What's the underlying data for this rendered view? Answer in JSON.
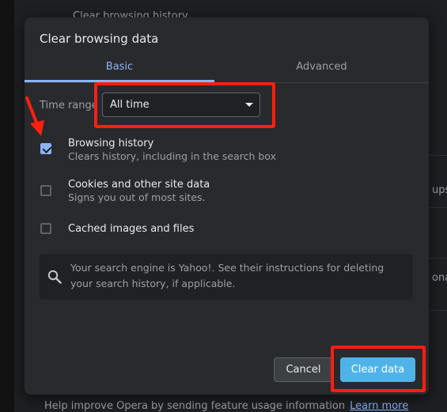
{
  "background": {
    "top_text": "Clear browsing history",
    "right_text_1": "ups,",
    "right_text_2": "onal",
    "bottom_text": "Help improve Opera by sending feature usage information",
    "bottom_link": "Learn more"
  },
  "dialog": {
    "title": "Clear browsing data",
    "tabs": [
      {
        "label": "Basic",
        "active": true
      },
      {
        "label": "Advanced",
        "active": false
      }
    ],
    "time_range": {
      "label": "Time range",
      "value": "All time"
    },
    "options": [
      {
        "title": "Browsing history",
        "subtitle": "Clears history, including in the search box",
        "checked": true
      },
      {
        "title": "Cookies and other site data",
        "subtitle": "Signs you out of most sites.",
        "checked": false
      },
      {
        "title": "Cached images and files",
        "subtitle": "",
        "checked": false
      }
    ],
    "info": {
      "icon": "search-icon",
      "text": "Your search engine is Yahoo!. See their instructions for deleting your search history, if applicable."
    },
    "buttons": {
      "cancel": "Cancel",
      "clear": "Clear data"
    }
  },
  "colors": {
    "accent": "#8ab4f8",
    "primary_button": "#4fb3e8",
    "annotation": "#ff1f0f"
  }
}
